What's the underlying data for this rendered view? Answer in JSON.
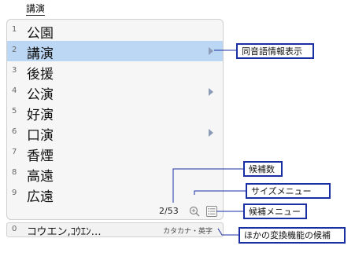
{
  "composing_text": "講演",
  "candidates": [
    {
      "num": "1",
      "word": "公園",
      "has_submenu": false
    },
    {
      "num": "2",
      "word": "講演",
      "has_submenu": true
    },
    {
      "num": "3",
      "word": "後援",
      "has_submenu": false
    },
    {
      "num": "4",
      "word": "公演",
      "has_submenu": true
    },
    {
      "num": "5",
      "word": "好演",
      "has_submenu": false
    },
    {
      "num": "6",
      "word": "口演",
      "has_submenu": true
    },
    {
      "num": "7",
      "word": "香煙",
      "has_submenu": false
    },
    {
      "num": "8",
      "word": "高遠",
      "has_submenu": false
    },
    {
      "num": "9",
      "word": "広遠",
      "has_submenu": false
    }
  ],
  "selected_index": 1,
  "counter": "2/53",
  "other_conversion": {
    "num": "0",
    "text": "コウエン,ｺｳｴﾝ…",
    "types": "カタカナ・英字"
  },
  "callouts": {
    "homonym_info": "同音語情報表示",
    "candidate_count": "候補数",
    "size_menu": "サイズメニュー",
    "candidate_menu": "候補メニュー",
    "other_conversion_candidates": "ほかの変換機能の候補"
  },
  "colors": {
    "callout_border": "#1a2fa3",
    "selection": "#bcd7f4",
    "submenu_arrow": "#8a9bb5"
  },
  "icons": {
    "zoom": "zoom-in-icon",
    "menu": "list-menu-icon",
    "arrow": "triangle-right-icon"
  }
}
